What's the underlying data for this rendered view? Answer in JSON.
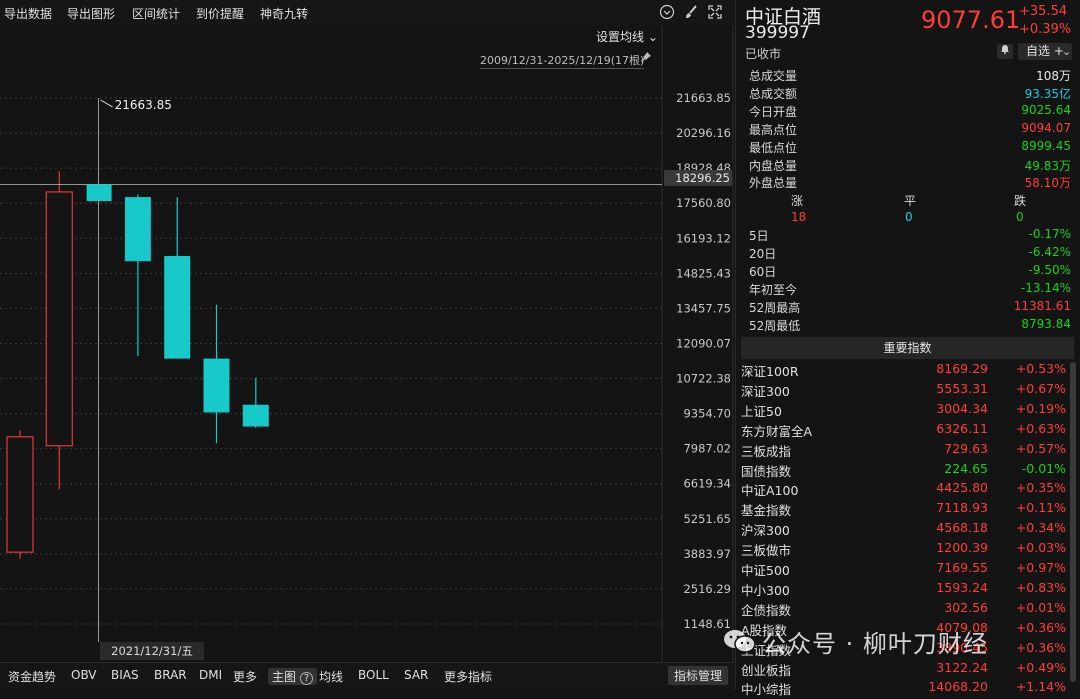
{
  "toolbar": {
    "items": [
      "导出数据",
      "导出图形",
      "区间统计",
      "到价提醒",
      "神奇九转"
    ],
    "icons": [
      "chevron-down-circle-icon",
      "brush-icon",
      "fullscreen-icon"
    ]
  },
  "chart": {
    "ma_setting": "设置均线",
    "range_label": "2009/12/31-2025/12/19(17根)",
    "crosshair_value": "18296.25",
    "crosshair_date": "2021/12/31/五",
    "peak_annotation": "21663.85",
    "colors": {
      "up": "#e23a3a",
      "down": "#17c9c9",
      "background": "#141414",
      "grid": "#3a3a3a"
    }
  },
  "chart_data": {
    "type": "candlestick",
    "y_axis_ticks": [
      "21663.85",
      "20296.16",
      "18928.48",
      "17560.80",
      "16193.12",
      "14825.43",
      "13457.75",
      "12090.07",
      "10722.38",
      "9354.70",
      "7987.02",
      "6619.34",
      "5251.65",
      "3883.97",
      "2516.29",
      "1148.61"
    ],
    "ylim": [
      1148.61,
      21663.85
    ],
    "candles": [
      {
        "open": 3950,
        "high": 8700,
        "low": 3700,
        "close": 8450
      },
      {
        "open": 8100,
        "high": 18800,
        "low": 6400,
        "close": 18000
      },
      {
        "open": 17800,
        "high": 21663.85,
        "low": 1148.61,
        "close": 18300
      },
      {
        "open": 17800,
        "high": 17900,
        "low": 11600,
        "close": 15300
      },
      {
        "open": 15500,
        "high": 17800,
        "low": 11700,
        "close": 11500
      },
      {
        "open": 11500,
        "high": 13600,
        "low": 8200,
        "close": 9400
      },
      {
        "open": 9700,
        "high": 10750,
        "low": 8800,
        "close": 8850
      }
    ]
  },
  "bottombar": {
    "items": [
      "资金趋势",
      "OBV",
      "BIAS",
      "BRAR",
      "DMI",
      "更多",
      "主图",
      "均线",
      "BOLL",
      "SAR",
      "更多指标"
    ],
    "indicator_manager": "指标管理"
  },
  "quote": {
    "name": "中证白酒",
    "code": "399997",
    "status": "已收市",
    "price": "9077.61",
    "change": "+35.54",
    "change_pct": "+0.39%",
    "watch_label": "自选",
    "add_label": "+"
  },
  "stats": [
    {
      "label": "总成交量",
      "value": "108万",
      "color": "white"
    },
    {
      "label": "总成交额",
      "value": "93.35亿",
      "color": "flat"
    },
    {
      "label": "今日开盘",
      "value": "9025.64",
      "color": "down"
    },
    {
      "label": "最高点位",
      "value": "9094.07",
      "color": "up"
    },
    {
      "label": "最低点位",
      "value": "8999.45",
      "color": "down"
    },
    {
      "label": "内盘总量",
      "value": "49.83万",
      "color": "down"
    },
    {
      "label": "外盘总量",
      "value": "58.10万",
      "color": "up"
    }
  ],
  "breadth": {
    "up_label": "涨",
    "flat_label": "平",
    "down_label": "跌",
    "up": "18",
    "flat": "0",
    "down": "0"
  },
  "returns": [
    {
      "label": "5日",
      "value": "-0.17%",
      "color": "down"
    },
    {
      "label": "20日",
      "value": "-6.42%",
      "color": "down"
    },
    {
      "label": "60日",
      "value": "-9.50%",
      "color": "down"
    },
    {
      "label": "年初至今",
      "value": "-13.14%",
      "color": "down"
    },
    {
      "label": "52周最高",
      "value": "11381.61",
      "color": "up"
    },
    {
      "label": "52周最低",
      "value": "8793.84",
      "color": "down"
    }
  ],
  "indices_header": "重要指数",
  "indices": [
    {
      "name": "深证100R",
      "price": "8169.29",
      "change": "+0.53%",
      "color": "up"
    },
    {
      "name": "深证300",
      "price": "5553.31",
      "change": "+0.67%",
      "color": "up"
    },
    {
      "name": "上证50",
      "price": "3004.34",
      "change": "+0.19%",
      "color": "up"
    },
    {
      "name": "东方财富全A",
      "price": "6326.11",
      "change": "+0.63%",
      "color": "up"
    },
    {
      "name": "三板成指",
      "price": "729.63",
      "change": "+0.57%",
      "color": "up"
    },
    {
      "name": "国债指数",
      "price": "224.65",
      "change": "-0.01%",
      "color": "down"
    },
    {
      "name": "中证A100",
      "price": "4425.80",
      "change": "+0.35%",
      "color": "up"
    },
    {
      "name": "基金指数",
      "price": "7118.93",
      "change": "+0.11%",
      "color": "up"
    },
    {
      "name": "沪深300",
      "price": "4568.18",
      "change": "+0.34%",
      "color": "up"
    },
    {
      "name": "三板做市",
      "price": "1200.39",
      "change": "+0.03%",
      "color": "up"
    },
    {
      "name": "中证500",
      "price": "7169.55",
      "change": "+0.97%",
      "color": "up"
    },
    {
      "name": "中小300",
      "price": "1593.24",
      "change": "+0.83%",
      "color": "up"
    },
    {
      "name": "企债指数",
      "price": "302.56",
      "change": "+0.01%",
      "color": "up"
    },
    {
      "name": "A股指数",
      "price": "4079.08",
      "change": "+0.36%",
      "color": "up"
    },
    {
      "name": "上证指数",
      "price": "3890.45",
      "change": "+0.36%",
      "color": "up"
    },
    {
      "name": "创业板指",
      "price": "3122.24",
      "change": "+0.49%",
      "color": "up"
    },
    {
      "name": "中小综指",
      "price": "14068.20",
      "change": "+1.14%",
      "color": "up"
    }
  ],
  "watermark": "公众号 · 柳叶刀财经"
}
